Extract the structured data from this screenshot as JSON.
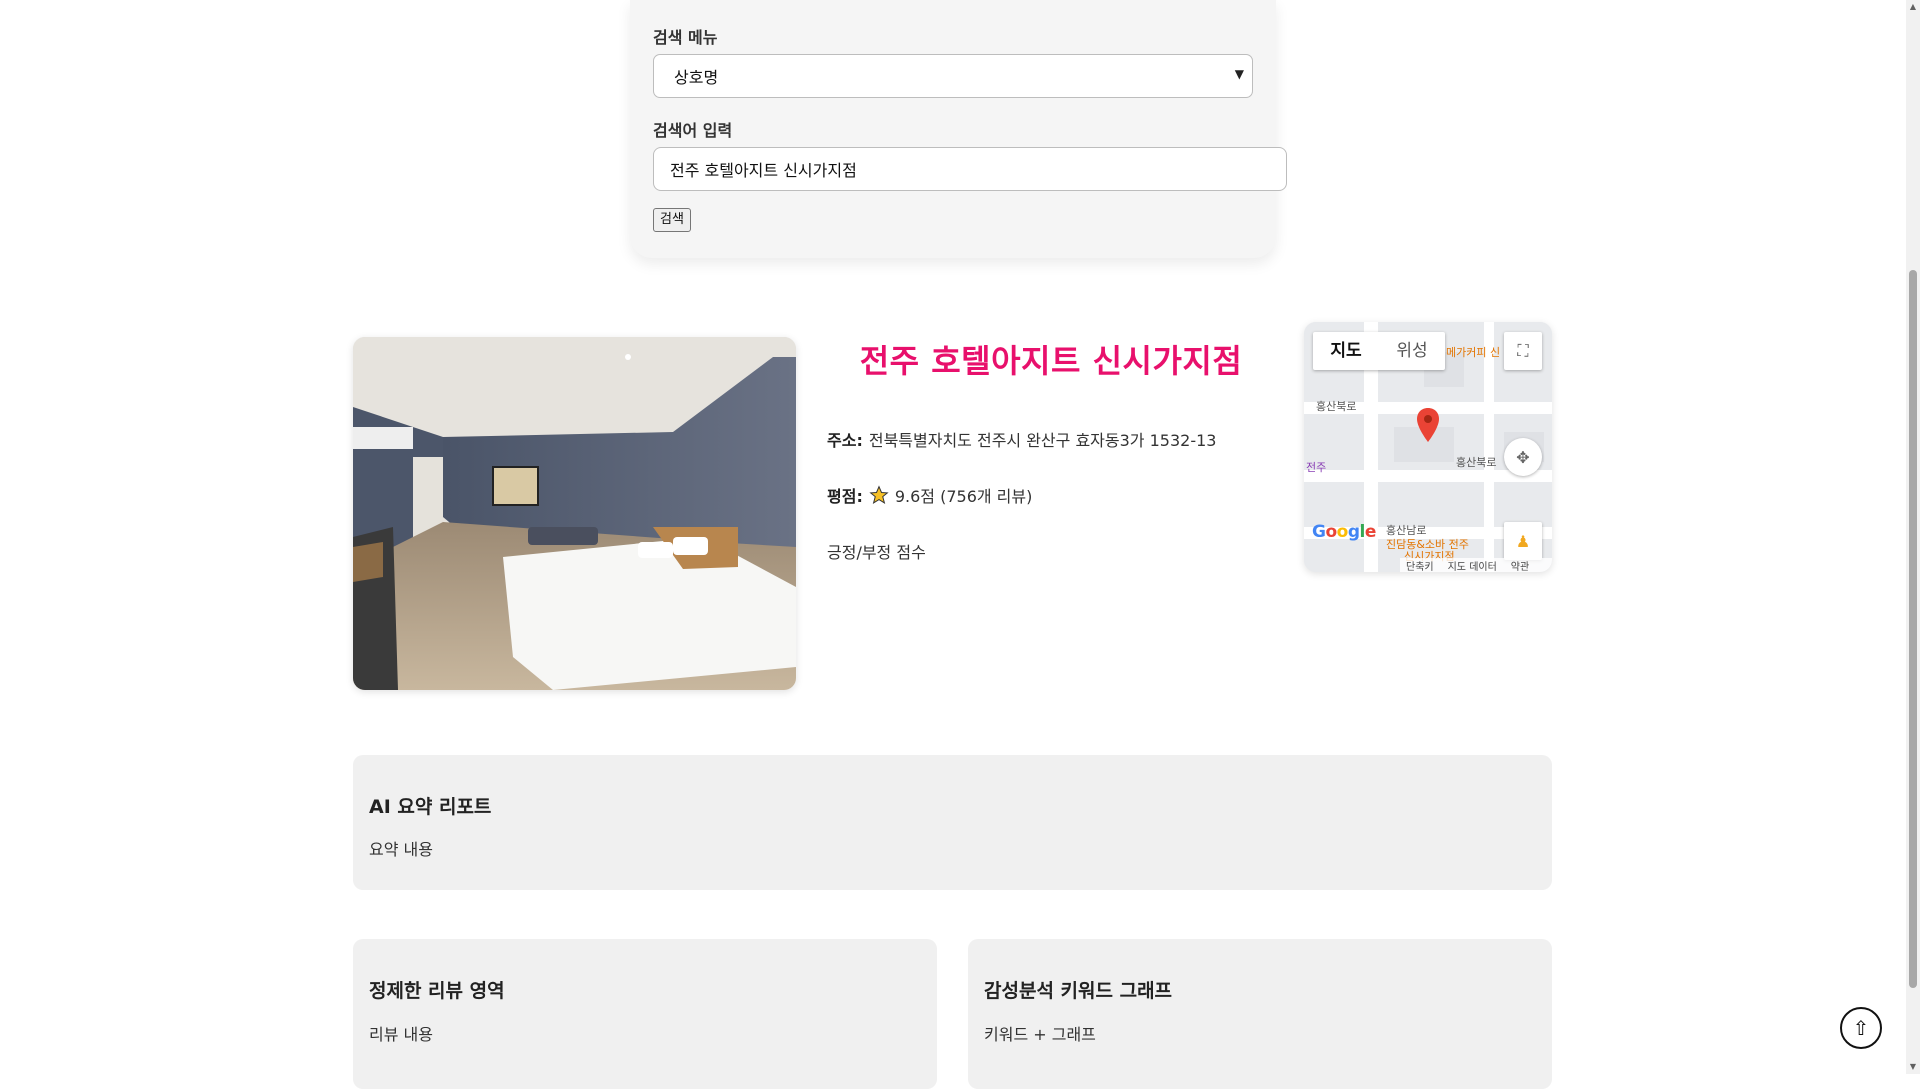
{
  "search": {
    "menu_label": "검색 메뉴",
    "menu_selected": "상호명",
    "input_label": "검색어 입력",
    "input_value": "전주 호텔아지트 신시가지점",
    "button_label": "검색"
  },
  "hotel": {
    "name": "전주 호텔아지트 신시가지점",
    "address_label": "주소:",
    "address": "전북특별자치도 전주시 완산구 효자동3가 1532-13",
    "rating_label": "평점:",
    "rating_text": "9.6점 (756개 리뷰)",
    "sentiment_text": "긍정/부정 점수",
    "accent_color": "#e8106c"
  },
  "map": {
    "tab_map": "지도",
    "tab_satellite": "위성",
    "labels": {
      "top_right": "메가커피 신",
      "road_top": "홍산북로",
      "road_mid": "홍산북로",
      "left_place": "전주",
      "road_bottom": "홍산남로",
      "place_bottom": "진담동&소바 전주",
      "place_bottom2": "신시가지점"
    },
    "logo": "Google",
    "footer": [
      "단축키",
      "지도 데이터",
      "약관"
    ]
  },
  "cards": {
    "ai_summary": {
      "title": "AI 요약 리포트",
      "body": "요약 내용"
    },
    "reviews": {
      "title": "정제한 리뷰 영역",
      "body": "리뷰 내용"
    },
    "keywords": {
      "title": "감성분석 키워드 그래프",
      "body": "키워드 + 그래프"
    }
  },
  "icons": {
    "top": "arrow-up-icon",
    "star": "star-icon",
    "fullscreen": "fullscreen-icon",
    "pegman": "pegman-icon",
    "pin": "map-pin-icon"
  }
}
